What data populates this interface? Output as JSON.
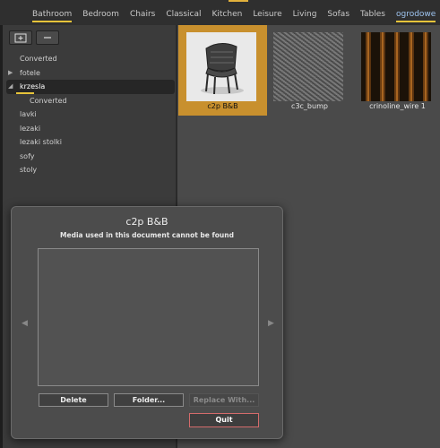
{
  "tabs": [
    {
      "label": "Bathroom"
    },
    {
      "label": "Bedroom"
    },
    {
      "label": "Chairs"
    },
    {
      "label": "Classical"
    },
    {
      "label": "Kitchen"
    },
    {
      "label": "Leisure"
    },
    {
      "label": "Living"
    },
    {
      "label": "Sofas"
    },
    {
      "label": "Tables"
    },
    {
      "label": "ogrodowe"
    }
  ],
  "tree": [
    {
      "label": "Converted"
    },
    {
      "label": "fotele"
    },
    {
      "label": "krzesla"
    },
    {
      "label": "Converted"
    },
    {
      "label": "lavki"
    },
    {
      "label": "lezaki"
    },
    {
      "label": "lezaki stolki"
    },
    {
      "label": "sofy"
    },
    {
      "label": "stoly"
    }
  ],
  "thumbs": [
    {
      "label": "c2p B&B"
    },
    {
      "label": "c3c_bump"
    },
    {
      "label": "crinoline_wire 1"
    }
  ],
  "dialog": {
    "title": "c2p B&B",
    "message": "Media used in this document cannot be found",
    "delete": "Delete",
    "folder": "Folder...",
    "replace": "Replace With...",
    "quit": "Quit"
  },
  "colors": {
    "accent": "#e6c33a",
    "selected_thumb": "#c8902e",
    "quit_border": "#d46b6b"
  }
}
